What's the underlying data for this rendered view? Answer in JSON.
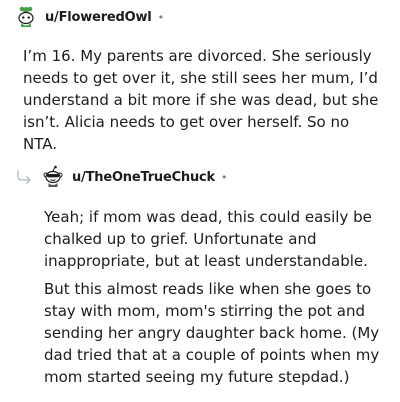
{
  "comments": [
    {
      "username": "u/FloweredOwl",
      "separator": "•",
      "paragraphs": [
        "I’m 16. My parents are divorced. She seriously needs to get over it, she still sees her mum, I’d understand a bit more if she was dead, but she isn’t. Alicia needs to get over herself. So no NTA."
      ]
    },
    {
      "username": "u/TheOneTrueChuck",
      "separator": "•",
      "paragraphs": [
        "Yeah; if mom was dead, this could easily be chalked up to grief. Unfortunate and inappropriate, but at least understandable.",
        "But this almost reads like when she goes to stay with mom, mom's stirring the pot and sending her angry daughter back home. (My dad tried that at a couple of points when my mom started seeing my future stepdad.)"
      ]
    }
  ],
  "icons": {
    "avatar1": "snoo-avatar-flower-icon",
    "avatar2": "snoo-avatar-icon",
    "reply": "reply-arrow-icon"
  },
  "colors": {
    "text": "#1c1c1c",
    "muted": "#7c7c7c",
    "avatar1_accent": "#46a049",
    "reply_line": "#b8c4cc"
  }
}
